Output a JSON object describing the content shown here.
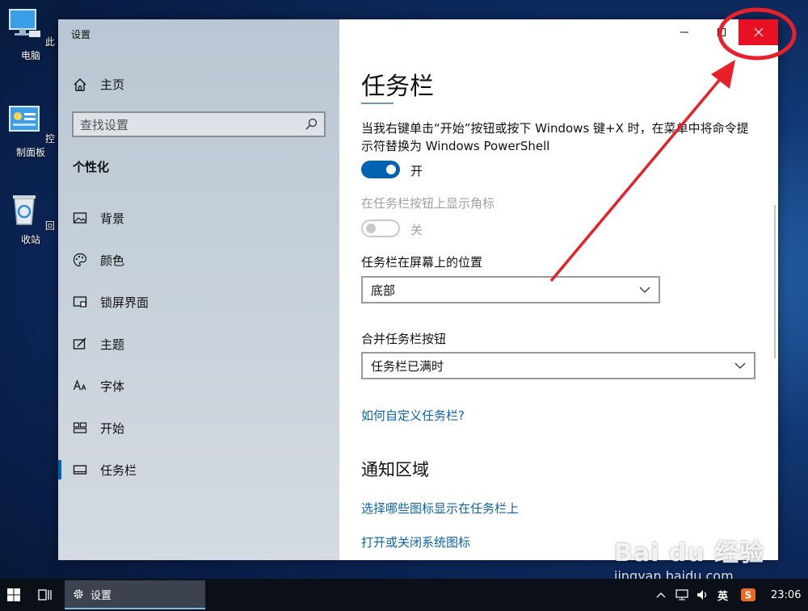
{
  "desktop": {
    "icons": [
      {
        "label": "此电脑",
        "icon": "computer-icon"
      },
      {
        "label": "控制面板",
        "icon": "control-panel-icon"
      },
      {
        "label": "回收站",
        "icon": "recycle-bin-icon"
      }
    ]
  },
  "window": {
    "app_title": "设置",
    "nav": {
      "home_label": "主页",
      "search_placeholder": "查找设置",
      "section_title": "个性化",
      "items": [
        {
          "label": "背景",
          "icon": "picture-icon"
        },
        {
          "label": "颜色",
          "icon": "palette-icon"
        },
        {
          "label": "锁屏界面",
          "icon": "lock-screen-icon"
        },
        {
          "label": "主题",
          "icon": "theme-icon"
        },
        {
          "label": "字体",
          "icon": "font-icon"
        },
        {
          "label": "开始",
          "icon": "start-icon"
        },
        {
          "label": "任务栏",
          "icon": "taskbar-icon",
          "active": true
        }
      ]
    },
    "content": {
      "title": "任务栏",
      "powershell_setting": "当我右键单击“开始”按钮或按下 Windows 键+X 时，在菜单中将命令提示符替换为 Windows PowerShell",
      "powershell_toggle": {
        "state": "开",
        "on": true
      },
      "badges_setting": "在任务栏按钮上显示角标",
      "badges_toggle": {
        "state": "关",
        "on": false
      },
      "position_label": "任务栏在屏幕上的位置",
      "position_value": "底部",
      "combine_label": "合并任务栏按钮",
      "combine_value": "任务栏已满时",
      "customize_link": "如何自定义任务栏?",
      "notification_heading": "通知区域",
      "select_icons_link": "选择哪些图标显示在任务栏上",
      "system_icons_link": "打开或关闭系统图标"
    }
  },
  "taskbar": {
    "app_label": "设置",
    "ime": "英",
    "time": "23:06"
  },
  "watermark": {
    "brand": "Bai du 经验",
    "url": "jingyan.baidu.com"
  },
  "colors": {
    "accent": "#0063b1",
    "close": "#e81123",
    "annotation": "#e8202a",
    "link": "#0a64ad"
  }
}
